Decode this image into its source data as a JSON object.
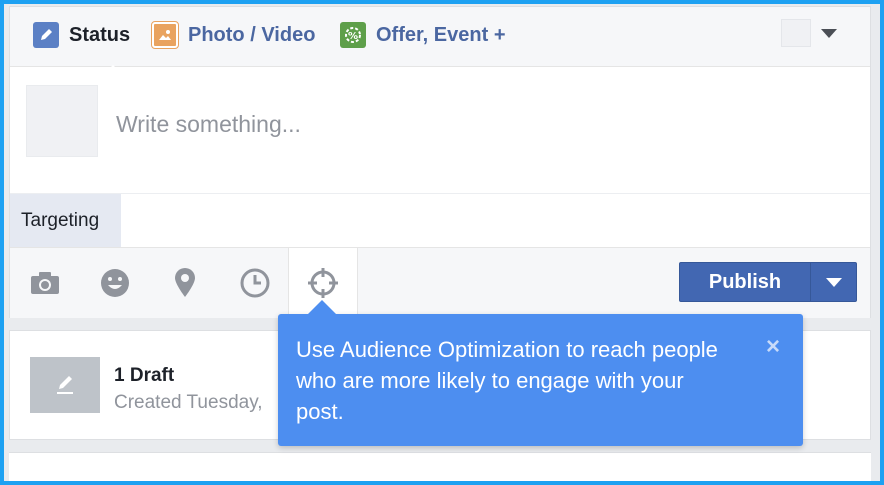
{
  "tabs": {
    "status": "Status",
    "photo_video": "Photo / Video",
    "offer_event": "Offer, Event +"
  },
  "composer": {
    "placeholder": "Write something...",
    "targeting_label": "Targeting",
    "publish_label": "Publish",
    "tools": [
      "camera-icon",
      "smiley-icon",
      "location-pin-icon",
      "clock-icon",
      "crosshair-icon"
    ]
  },
  "draft": {
    "title": "1 Draft",
    "subtitle": "Created Tuesday,"
  },
  "tooltip": {
    "text": "Use Audience Optimization to reach people who are more likely to engage with your post.",
    "close": "×"
  },
  "colors": {
    "accent": "#4267b2",
    "tooltip_bg": "#4d8ef0",
    "frame": "#1da1f2"
  }
}
